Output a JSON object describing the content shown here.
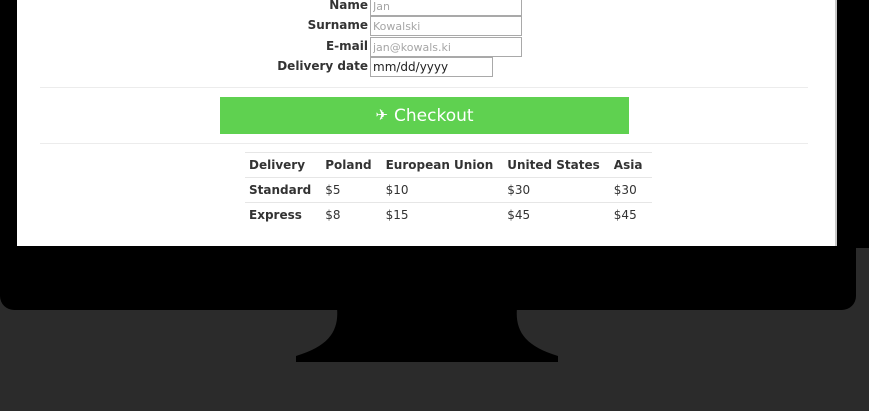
{
  "form": {
    "name": {
      "label": "Name",
      "value": "",
      "placeholder": "Jan"
    },
    "surname": {
      "label": "Surname",
      "value": "",
      "placeholder": "Kowalski"
    },
    "email": {
      "label": "E-mail",
      "value": "",
      "placeholder": "jan@kowals.ki"
    },
    "delivery_date": {
      "label": "Delivery date",
      "value": "mm/dd/yyyy"
    }
  },
  "checkout": {
    "icon": "airplane-icon",
    "label": "Checkout",
    "color": "#5fd150"
  },
  "shipping_table": {
    "headers": [
      "Delivery",
      "Poland",
      "European Union",
      "United States",
      "Asia"
    ],
    "rows": [
      [
        "Standard",
        "$5",
        "$10",
        "$30",
        "$30"
      ],
      [
        "Express",
        "$8",
        "$15",
        "$45",
        "$45"
      ]
    ]
  },
  "colors": {
    "monitor": "#000000",
    "background": "#2b2b2b",
    "screen": "#ffffff"
  }
}
